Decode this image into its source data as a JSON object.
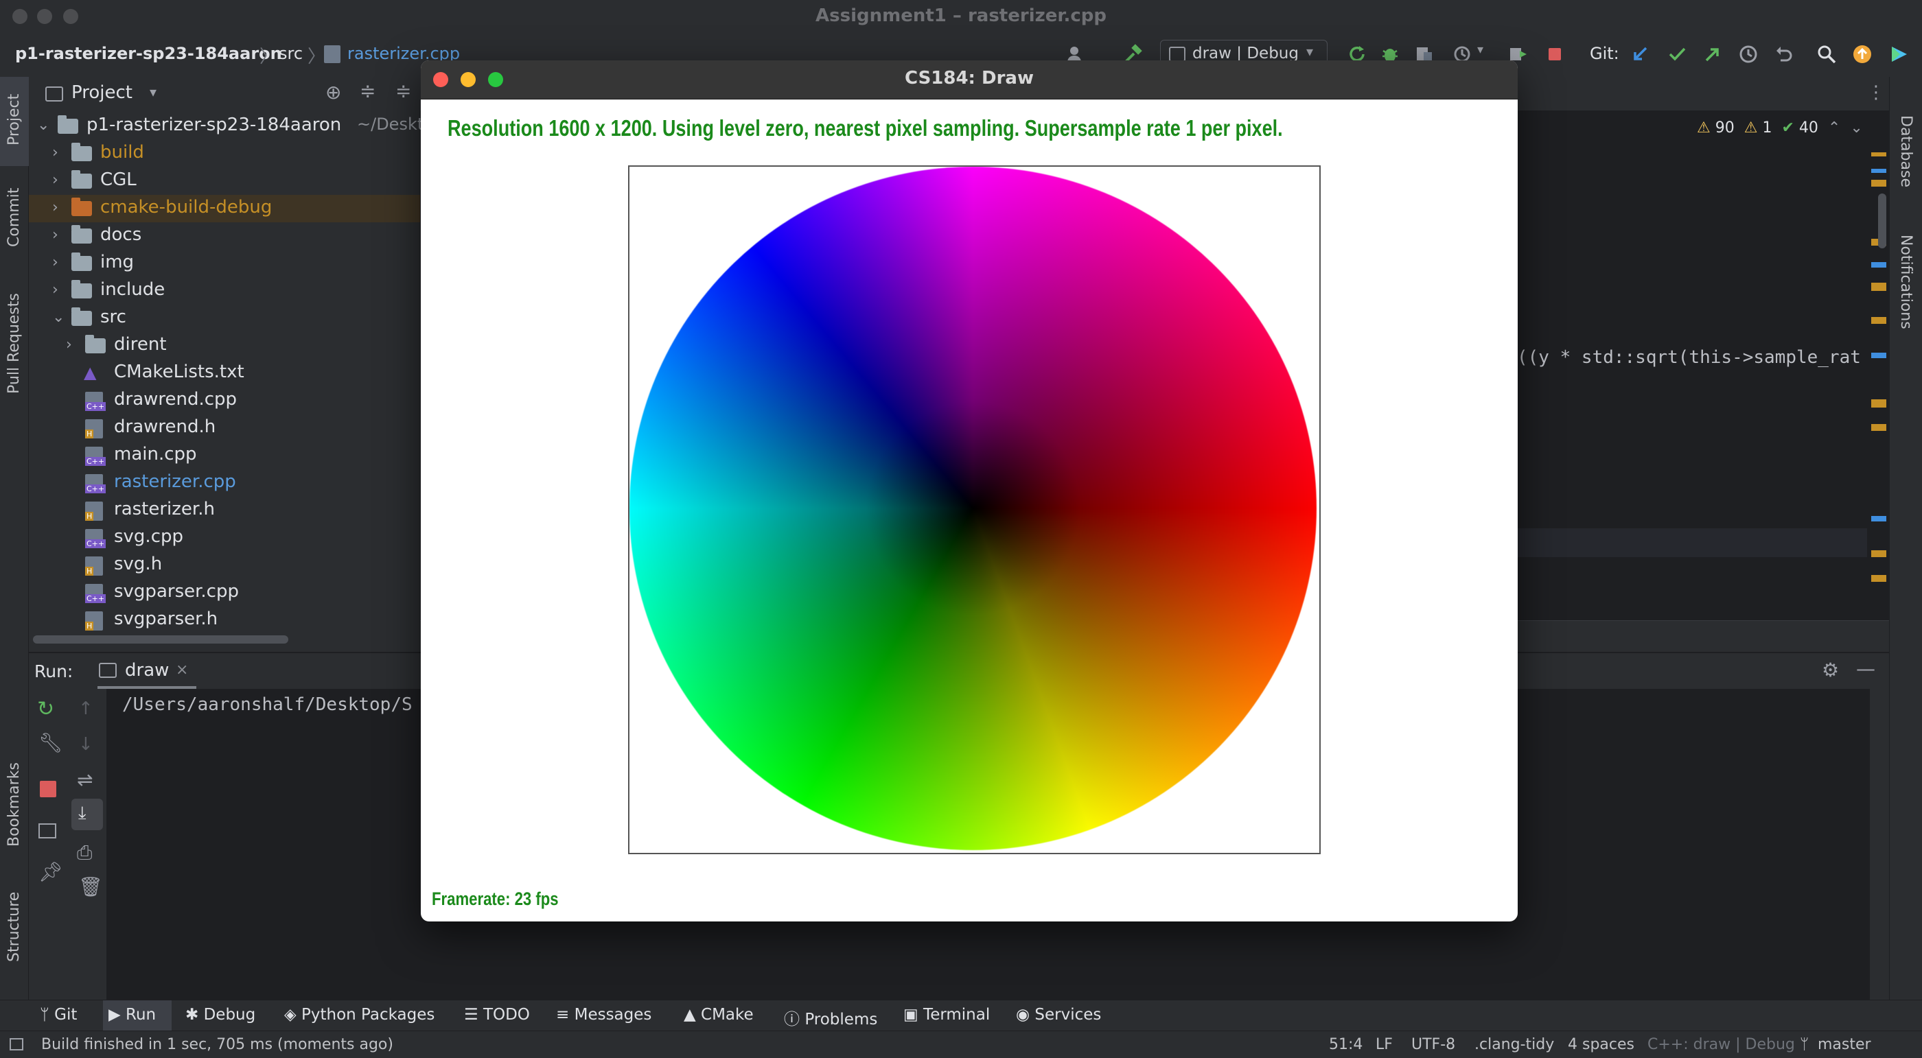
{
  "window": {
    "title": "Assignment1 – rasterizer.cpp"
  },
  "nav": {
    "project": "p1-rasterizer-sp23-184aaron",
    "folder": "src",
    "file": "rasterizer.cpp",
    "run_config": "draw | Debug",
    "git_label": "Git:"
  },
  "side_tools": {
    "left": [
      "Project",
      "Commit",
      "Pull Requests",
      "Bookmarks",
      "Structure"
    ],
    "right": [
      "Database",
      "Notifications"
    ]
  },
  "project_panel": {
    "title": "Project",
    "root": {
      "name": "p1-rasterizer-sp23-184aaron",
      "path": "~/Desktop"
    },
    "items": [
      {
        "label": "build",
        "kind": "folder",
        "color": "#c69026"
      },
      {
        "label": "CGL",
        "kind": "folder",
        "color": "#dfe1e5"
      },
      {
        "label": "cmake-build-debug",
        "kind": "folder-orange",
        "color": "#c69026"
      },
      {
        "label": "docs",
        "kind": "folder",
        "color": "#dfe1e5"
      },
      {
        "label": "img",
        "kind": "folder",
        "color": "#dfe1e5"
      },
      {
        "label": "include",
        "kind": "folder",
        "color": "#dfe1e5"
      },
      {
        "label": "src",
        "kind": "folder-open",
        "color": "#dfe1e5"
      },
      {
        "label": "dirent",
        "kind": "subfolder",
        "color": "#dfe1e5"
      },
      {
        "label": "CMakeLists.txt",
        "kind": "cmake",
        "color": "#dfe1e5"
      },
      {
        "label": "drawrend.cpp",
        "kind": "cpp",
        "color": "#dfe1e5"
      },
      {
        "label": "drawrend.h",
        "kind": "h",
        "color": "#dfe1e5"
      },
      {
        "label": "main.cpp",
        "kind": "cpp",
        "color": "#dfe1e5"
      },
      {
        "label": "rasterizer.cpp",
        "kind": "cpp",
        "color": "#5a9bdc"
      },
      {
        "label": "rasterizer.h",
        "kind": "h",
        "color": "#dfe1e5"
      },
      {
        "label": "svg.cpp",
        "kind": "cpp",
        "color": "#dfe1e5"
      },
      {
        "label": "svg.h",
        "kind": "h",
        "color": "#dfe1e5"
      },
      {
        "label": "svgparser.cpp",
        "kind": "cpp",
        "color": "#dfe1e5"
      },
      {
        "label": "svgparser.h",
        "kind": "h",
        "color": "#dfe1e5"
      }
    ]
  },
  "editor": {
    "inspections": {
      "warnings": "90",
      "weak_warnings": "1",
      "ok": "40"
    },
    "code_fragment": "((y * std::sqrt(this->sample_rat"
  },
  "run_panel": {
    "label": "Run:",
    "tab": "draw",
    "output": "/Users/aaronshalf/Desktop/S"
  },
  "bottom_tabs": [
    "Git",
    "Run",
    "Debug",
    "Python Packages",
    "TODO",
    "Messages",
    "CMake",
    "Problems",
    "Terminal",
    "Services"
  ],
  "status_bar": {
    "message": "Build finished in 1 sec, 705 ms (moments ago)",
    "position": "51:4",
    "line_sep": "LF",
    "encoding": "UTF-8",
    "linter": ".clang-tidy",
    "indent": "4 spaces",
    "context": "C++: draw | Debug",
    "branch": "master"
  },
  "draw_window": {
    "title": "CS184: Draw",
    "resolution_text": "Resolution 1600 x 1200. Using level zero, nearest pixel sampling. Supersample rate 1 per pixel.",
    "framerate_text": "Framerate: 23 fps",
    "text_color": "#1b8a1b"
  }
}
